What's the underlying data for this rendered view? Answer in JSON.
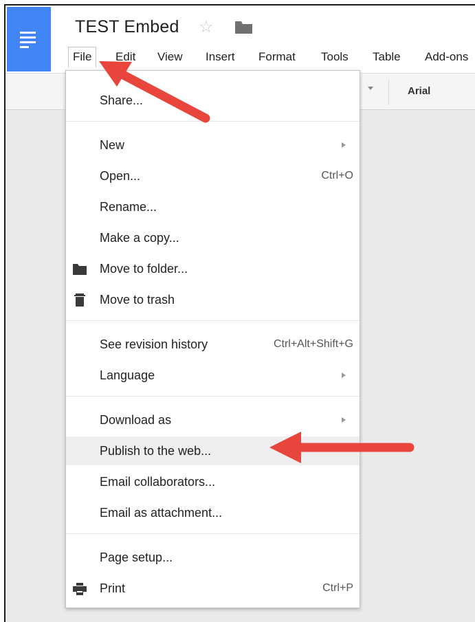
{
  "document": {
    "title": "TEST Embed",
    "icons": {
      "app": "docs-app-icon",
      "star": "star-icon",
      "folder": "folder-icon"
    }
  },
  "menubar": {
    "items": [
      "File",
      "Edit",
      "View",
      "Insert",
      "Format",
      "Tools",
      "Table",
      "Add-ons"
    ],
    "active": "File"
  },
  "toolbar": {
    "font": "Arial"
  },
  "file_menu": {
    "items": [
      {
        "label": "Share..."
      },
      {
        "label": "New",
        "submenu": true
      },
      {
        "label": "Open...",
        "shortcut": "Ctrl+O"
      },
      {
        "label": "Rename..."
      },
      {
        "label": "Make a copy..."
      },
      {
        "label": "Move to folder...",
        "icon": "folder-icon"
      },
      {
        "label": "Move to trash",
        "icon": "trash-icon"
      },
      {
        "label": "See revision history",
        "shortcut": "Ctrl+Alt+Shift+G"
      },
      {
        "label": "Language",
        "submenu": true
      },
      {
        "label": "Download as",
        "submenu": true
      },
      {
        "label": "Publish to the web...",
        "highlighted": true
      },
      {
        "label": "Email collaborators..."
      },
      {
        "label": "Email as attachment..."
      },
      {
        "label": "Page setup..."
      },
      {
        "label": "Print",
        "shortcut": "Ctrl+P",
        "icon": "print-icon"
      }
    ]
  },
  "annotations": {
    "arrow_color": "#e8453c",
    "arrows": [
      "arrow-to-file-menu",
      "arrow-to-publish-to-web"
    ]
  },
  "colors": {
    "accent": "#4285f4",
    "menu_highlight": "#eeeeee"
  }
}
